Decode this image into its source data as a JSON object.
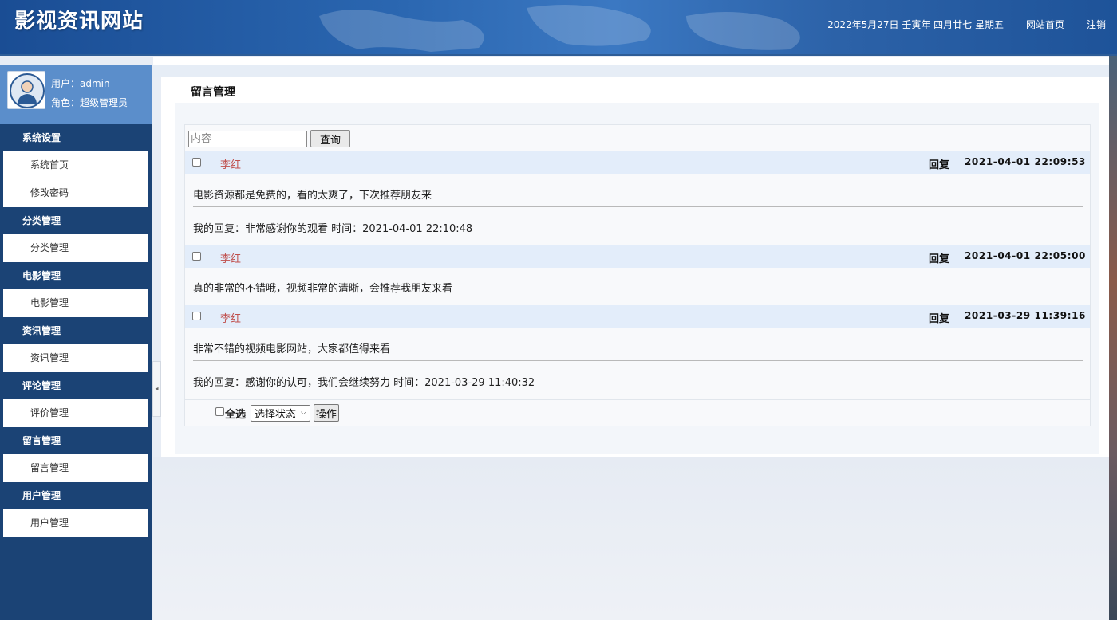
{
  "header": {
    "site_title": "影视资讯网站",
    "date_text": "2022年5月27日 壬寅年 四月廿七 星期五",
    "home_link": "网站首页",
    "logout_link": "注销"
  },
  "user": {
    "name_text": "用户：admin",
    "role_text": "角色：超级管理员"
  },
  "sidebar": {
    "groups": [
      {
        "title": "系统设置",
        "items": [
          "系统首页",
          "修改密码"
        ]
      },
      {
        "title": "分类管理",
        "items": [
          "分类管理"
        ]
      },
      {
        "title": "电影管理",
        "items": [
          "电影管理"
        ]
      },
      {
        "title": "资讯管理",
        "items": [
          "资讯管理"
        ]
      },
      {
        "title": "评论管理",
        "items": [
          "评价管理"
        ]
      },
      {
        "title": "留言管理",
        "items": [
          "留言管理"
        ]
      },
      {
        "title": "用户管理",
        "items": [
          "用户管理"
        ]
      }
    ],
    "toggle_glyph": "◂"
  },
  "main": {
    "title": "留言管理",
    "search_placeholder": "内容",
    "search_button": "查询",
    "reply_label": "回复",
    "messages": [
      {
        "author": "李红",
        "time": "2021-04-01 22:09:53",
        "content": "电影资源都是免费的，看的太爽了，下次推荐朋友来",
        "reply": "我的回复：非常感谢你的观看 时间：2021-04-01 22:10:48"
      },
      {
        "author": "李红",
        "time": "2021-04-01 22:05:00",
        "content": "真的非常的不错哦，视频非常的清晰，会推荐我朋友来看",
        "reply": ""
      },
      {
        "author": "李红",
        "time": "2021-03-29 11:39:16",
        "content": "非常不错的视频电影网站，大家都值得来看",
        "reply": "我的回复：感谢你的认可，我们会继续努力 时间：2021-03-29 11:40:32"
      }
    ],
    "select_all_label": "全选",
    "status_select": "选择状态",
    "action_button": "操作"
  },
  "colors": {
    "header_blue": "#1e5399",
    "sidebar_navy": "#1b4375",
    "userbox_blue": "#5b8ecb",
    "author_red": "#c0504d",
    "row_head_blue": "#e3edfa"
  }
}
